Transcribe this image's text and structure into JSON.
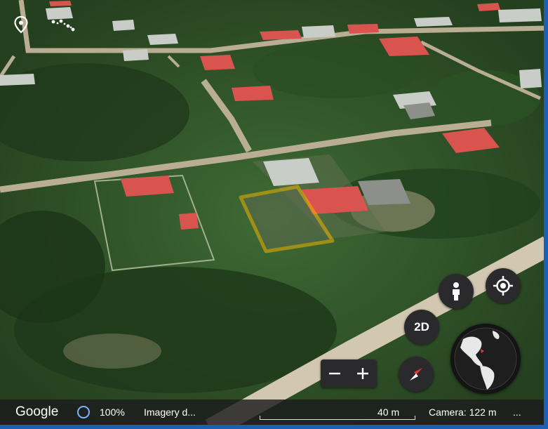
{
  "map": {
    "view_mode": "3D satellite",
    "selection_outline_color": "#f0b400"
  },
  "controls": {
    "place_icon": "map-pin-icon",
    "measure_icon": "measure-path-icon",
    "mode_toggle_label": "2D",
    "pegman_icon": "person-icon",
    "locate_icon": "my-location-icon",
    "zoom_out_label": "−",
    "zoom_in_label": "+",
    "compass_icon": "compass-icon",
    "globe_icon": "globe-icon",
    "accent_color": "#7fb2ff",
    "compass_north_color": "#e53935"
  },
  "status": {
    "logo": "Google",
    "loading_icon": "loading-ring-icon",
    "load_percent": "100%",
    "imagery_text": "Imagery d...",
    "scale_label": "40 m",
    "camera_text": "Camera: 122 m",
    "more": "..."
  }
}
